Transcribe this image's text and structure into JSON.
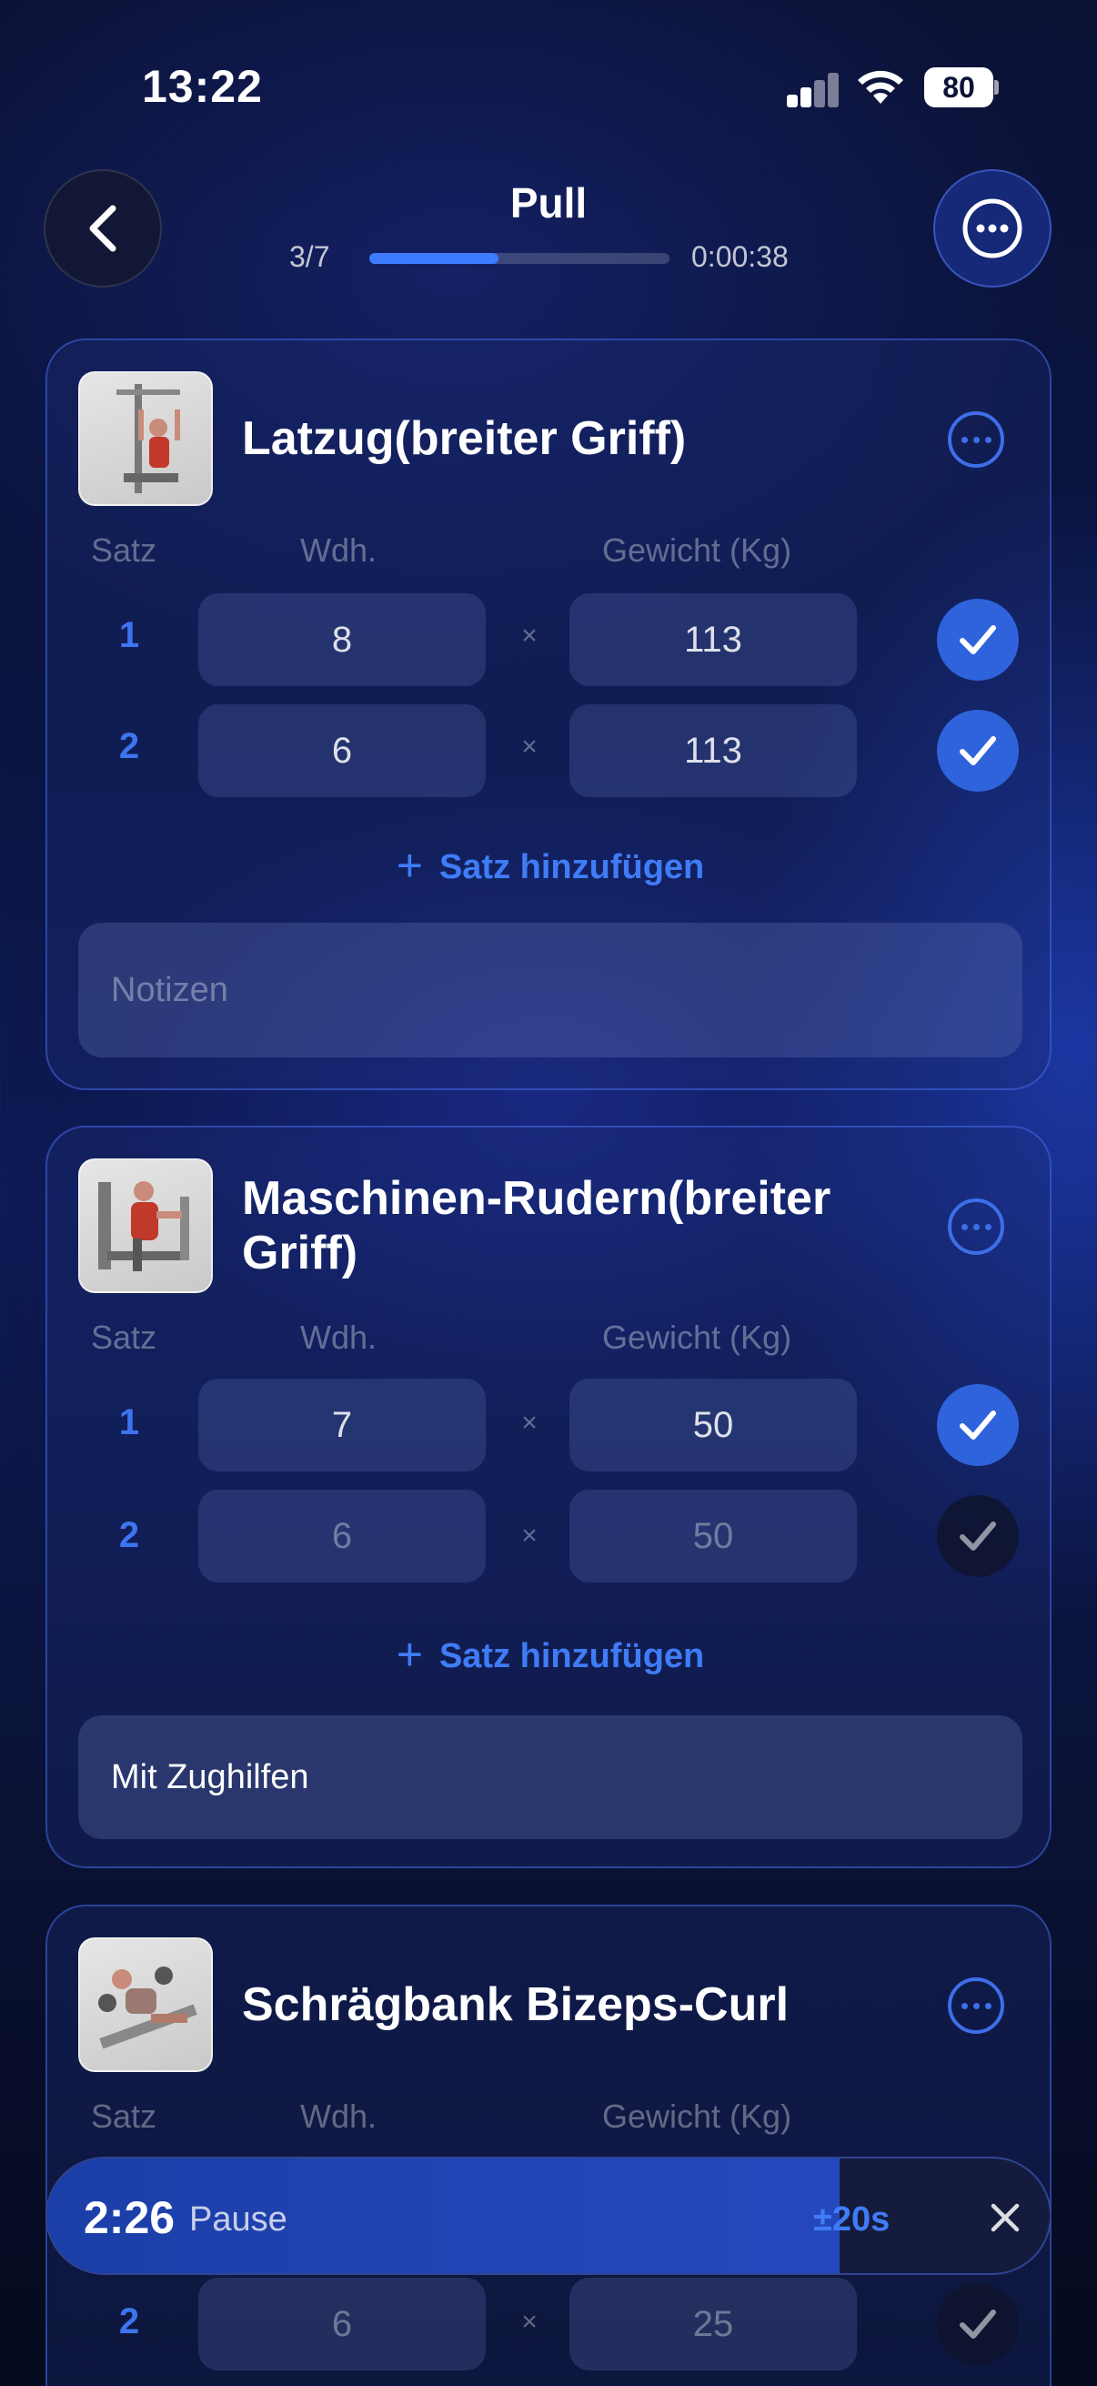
{
  "status": {
    "time": "13:22",
    "battery": "80"
  },
  "header": {
    "title": "Pull",
    "progress_label": "3/7",
    "progress_fraction": 0.43,
    "elapsed": "0:00:38"
  },
  "columns": {
    "set": "Satz",
    "reps": "Wdh.",
    "weight": "Gewicht (Kg)"
  },
  "add_set_label": "Satz hinzufügen",
  "exercises": [
    {
      "name": "Latzug(breiter Griff)",
      "sets": [
        {
          "num": "1",
          "reps": "8",
          "weight": "113",
          "done": true
        },
        {
          "num": "2",
          "reps": "6",
          "weight": "113",
          "done": true
        }
      ],
      "notes": "Notizen"
    },
    {
      "name": "Maschinen-Rudern(breiter Griff)",
      "sets": [
        {
          "num": "1",
          "reps": "7",
          "weight": "50",
          "done": true
        },
        {
          "num": "2",
          "reps": "6",
          "weight": "50",
          "done": false
        }
      ],
      "notes": "Mit Zughilfen"
    },
    {
      "name": "Schrägbank Bizeps-Curl",
      "sets": [
        {
          "num": "2",
          "reps": "6",
          "weight": "25",
          "done": false
        }
      ]
    }
  ],
  "times_symbol": "×",
  "rest": {
    "time": "2:26",
    "label": "Pause",
    "adjust": "±20s",
    "remaining_fraction": 0.79
  },
  "colors": {
    "accent": "#3d7bff",
    "check_done": "#2f63dc"
  }
}
